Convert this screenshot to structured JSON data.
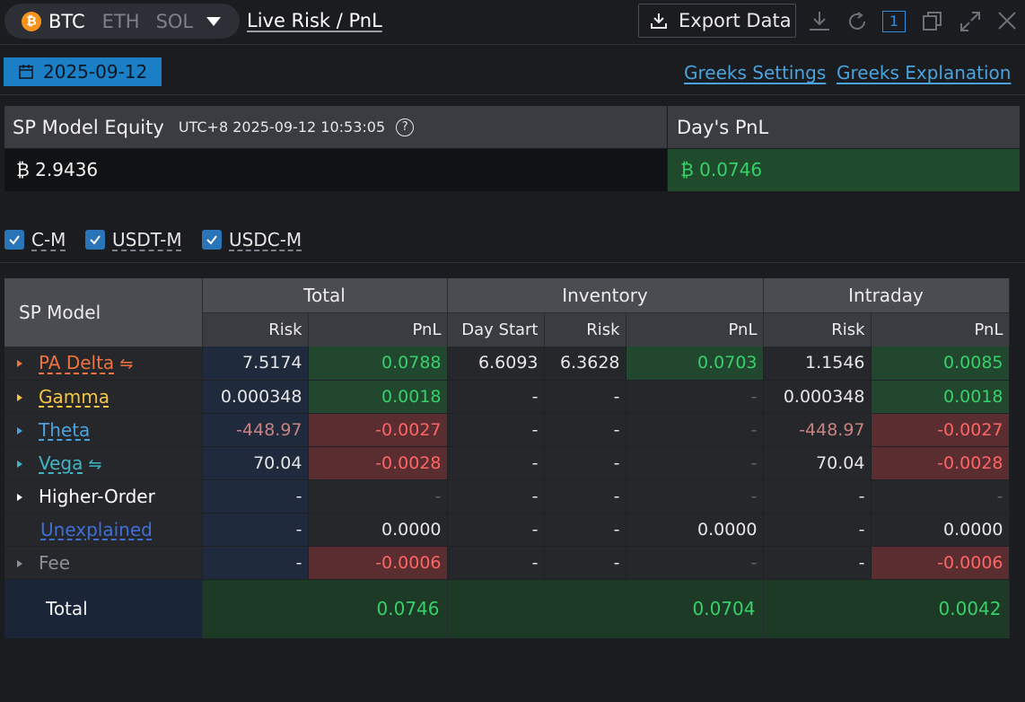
{
  "header": {
    "assets": [
      "BTC",
      "ETH",
      "SOL"
    ],
    "active_asset": "BTC",
    "btc_symbol": "₿",
    "title": "Live Risk / PnL",
    "export_label": "Export Data",
    "window_number": "1"
  },
  "toolbar": {
    "date": "2025-09-12",
    "greeks_settings": "Greeks Settings",
    "greeks_explanation": "Greeks Explanation"
  },
  "equity": {
    "label": "SP Model Equity",
    "timestamp": "UTC+8 2025-09-12 10:53:05",
    "help": "?",
    "value": "₿ 2.9436",
    "days_pnl_label": "Day's PnL",
    "days_pnl_value": "₿ 0.0746"
  },
  "filters": [
    {
      "label": "C-M",
      "checked": true
    },
    {
      "label": "USDT-M",
      "checked": true
    },
    {
      "label": "USDC-M",
      "checked": true
    }
  ],
  "table": {
    "corner": "SP Model",
    "groups": [
      "Total",
      "Inventory",
      "Intraday"
    ],
    "columns": [
      "Risk",
      "PnL",
      "Day Start",
      "Risk",
      "PnL",
      "Risk",
      "PnL"
    ],
    "rows": [
      {
        "name": "PA Delta",
        "swap": "⇋",
        "color": "#f0733f",
        "vals": [
          "7.5174",
          "0.0788",
          "6.6093",
          "6.3628",
          "0.0703",
          "1.1546",
          "0.0085"
        ]
      },
      {
        "name": "Gamma",
        "color": "#f5c542",
        "vals": [
          "0.000348",
          "0.0018",
          "-",
          "-",
          "-",
          "0.000348",
          "0.0018"
        ]
      },
      {
        "name": "Theta",
        "color": "#4aa3df",
        "vals": [
          "-448.97",
          "-0.0027",
          "-",
          "-",
          "-",
          "-448.97",
          "-0.0027"
        ]
      },
      {
        "name": "Vega",
        "swap": "⇋",
        "color": "#3fb6c4",
        "vals": [
          "70.04",
          "-0.0028",
          "-",
          "-",
          "-",
          "70.04",
          "-0.0028"
        ]
      },
      {
        "name": "Higher-Order",
        "color": "#ffffff",
        "vals": [
          "-",
          "-",
          "-",
          "-",
          "-",
          "-",
          "-"
        ]
      },
      {
        "name": "Unexplained",
        "color": "#3f6fd6",
        "vals": [
          "-",
          "0.0000",
          "-",
          "-",
          "0.0000",
          "-",
          "0.0000"
        ]
      },
      {
        "name": "Fee",
        "color": "#8a9099",
        "vals": [
          "-",
          "-0.0006",
          "-",
          "-",
          "-",
          "-",
          "-0.0006"
        ]
      }
    ],
    "total": {
      "label": "Total",
      "total_pnl": "0.0746",
      "inventory_pnl": "0.0704",
      "intraday_pnl": "0.0042"
    }
  }
}
